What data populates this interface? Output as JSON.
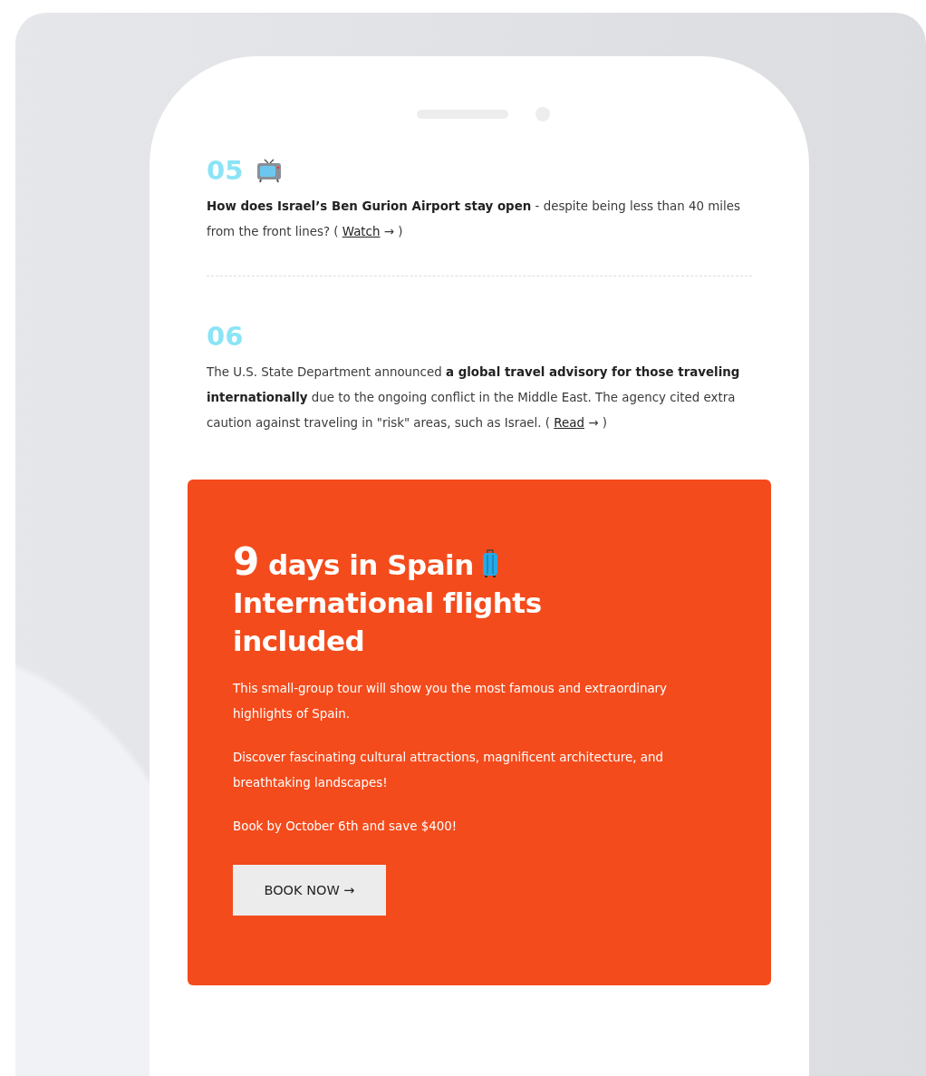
{
  "news_items": [
    {
      "number": "05",
      "kind": "video",
      "text": "**How does Israel’s Ben Gurion Airport stay open** - despite being less than 40 miles from the front lines? ( ",
      "link": "Watch",
      "after": " → )"
    },
    {
      "number": "06",
      "kind": "article",
      "text": "The U.S. State Department announced **a global travel advisory for those traveling internationally** due to the ongoing conflict in the Middle East. The agency cited extra caution against traveling in \"risk\" areas, such as Israel. ( ",
      "link": "Read",
      "after": " → )"
    }
  ],
  "promo": {
    "number": "9",
    "title": "days in Spain",
    "subtitle": "International flights included",
    "paragraphs": [
      "This small-group tour will show you the most famous and extraordinary highlights of Spain.",
      "Discover fascinating cultural attractions, magnificent architecture, and breathtaking landscapes!",
      "Book by October 6th and save $400!"
    ],
    "button": "BOOK NOW →"
  }
}
